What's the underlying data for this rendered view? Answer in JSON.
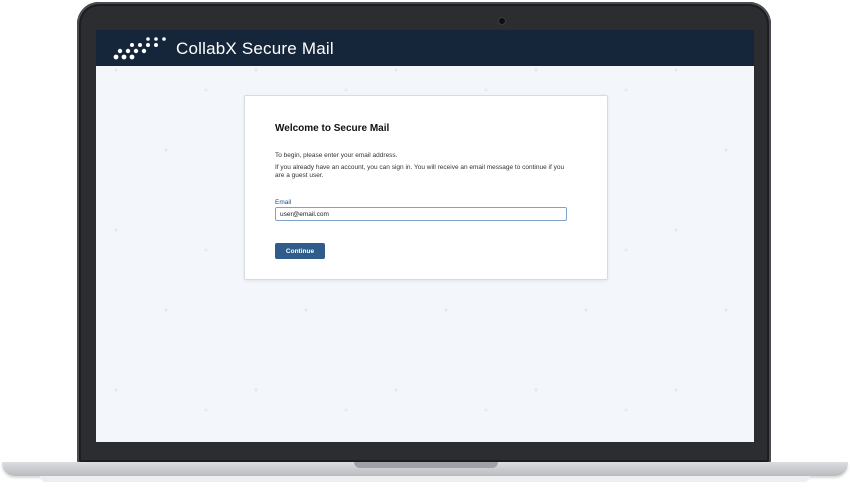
{
  "header": {
    "app_title": "CollabX Secure Mail",
    "logo_icon": "dots-logo-icon",
    "background_color": "#16263a"
  },
  "card": {
    "title": "Welcome to Secure Mail",
    "intro_text": "To begin, please enter your email address.",
    "detail_text": "If you already have an account, you can sign in. You will receive an email message to continue if you are a guest user.",
    "email_label": "Email",
    "email_value": "user@email.com",
    "continue_label": "Continue"
  },
  "colors": {
    "accent": "#2f5c8a",
    "page_background": "#f3f7fb"
  }
}
